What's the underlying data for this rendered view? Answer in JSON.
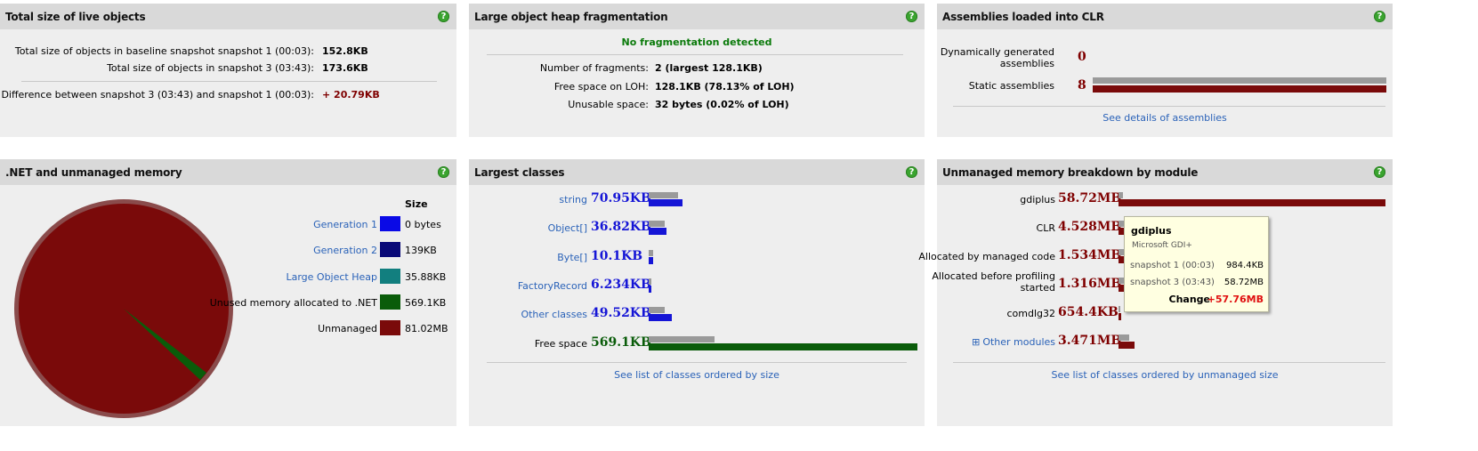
{
  "colors": {
    "managed_bar": "#1515d6",
    "baseline_bar": "#9a9a9a",
    "free_bar": "#0a5c0a",
    "unmanaged_bar": "#7a0a0a",
    "help_icon": "#3aa42f"
  },
  "live": {
    "title": "Total size of live objects",
    "rows": [
      {
        "label": "Total size of objects in baseline snapshot snapshot 1 (00:03):",
        "value": "152.8KB"
      },
      {
        "label": "Total size of objects in snapshot 3 (03:43):",
        "value": "173.6KB"
      }
    ],
    "diff_label": "Difference between snapshot 3 (03:43) and snapshot 1 (00:03):",
    "diff_value": "+ 20.79KB"
  },
  "loh": {
    "title": "Large object heap fragmentation",
    "status": "No fragmentation detected",
    "rows": [
      {
        "label": "Number of fragments:",
        "value": "2 (largest 128.1KB)"
      },
      {
        "label": "Free space on LOH:",
        "value": "128.1KB (78.13% of LOH)"
      },
      {
        "label": "Unusable space:",
        "value": "32 bytes (0.02% of LOH)"
      }
    ]
  },
  "assemblies": {
    "title": "Assemblies loaded into CLR",
    "dynamic_label_1": "Dynamically generated",
    "dynamic_label_2": "assemblies",
    "dynamic_value": "0",
    "static_label": "Static assemblies",
    "static_value": "8",
    "static_fraction": 1.0,
    "link": "See details of assemblies"
  },
  "net": {
    "title": ".NET and unmanaged memory",
    "size_header": "Size",
    "legend": [
      {
        "label": "Generation 1",
        "value": "0 bytes",
        "color": "#0a0ae6",
        "link": true
      },
      {
        "label": "Generation 2",
        "value": "139KB",
        "color": "#0a0a78",
        "link": true
      },
      {
        "label": "Large Object Heap",
        "value": "35.88KB",
        "color": "#127f7f",
        "link": true
      },
      {
        "label": "Unused memory allocated to .NET",
        "value": "569.1KB",
        "color": "#0a5c0a",
        "link": false
      },
      {
        "label": "Unmanaged",
        "value": "81.02MB",
        "color": "#7a0a0a",
        "link": false
      }
    ]
  },
  "classes": {
    "title": "Largest classes",
    "rows": [
      {
        "name": "string",
        "value": "70.95KB",
        "baseline_kb": 62.0,
        "current_kb": 70.95,
        "link": true,
        "kind": "managed"
      },
      {
        "name": "Object[]",
        "value": "36.82KB",
        "baseline_kb": 33.0,
        "current_kb": 36.82,
        "link": true,
        "kind": "managed"
      },
      {
        "name": "Byte[]",
        "value": "10.1KB",
        "baseline_kb": 9.0,
        "current_kb": 10.1,
        "link": true,
        "kind": "managed"
      },
      {
        "name": "FactoryRecord",
        "value": "6.234KB",
        "baseline_kb": 5.5,
        "current_kb": 6.234,
        "link": true,
        "kind": "managed"
      },
      {
        "name": "Other classes",
        "value": "49.52KB",
        "baseline_kb": 33.0,
        "current_kb": 49.52,
        "link": true,
        "kind": "managed"
      },
      {
        "name": "Free space",
        "value": "569.1KB",
        "baseline_kb": 140.0,
        "current_kb": 569.1,
        "link": false,
        "kind": "free"
      }
    ],
    "link": "See list of classes ordered by size"
  },
  "unmanaged": {
    "title": "Unmanaged memory breakdown by module",
    "rows": [
      {
        "name_1": "gdiplus",
        "name_2": "",
        "value": "58.72MB",
        "baseline_mb": 0.98,
        "current_mb": 58.72,
        "link": false
      },
      {
        "name_1": "CLR",
        "name_2": "",
        "value": "4.528MB",
        "baseline_mb": 4.2,
        "current_mb": 4.528,
        "link": false
      },
      {
        "name_1": "Allocated by managed code",
        "name_2": "",
        "value": "1.534MB",
        "baseline_mb": 1.3,
        "current_mb": 1.534,
        "link": false
      },
      {
        "name_1": "Allocated before profiling",
        "name_2": "started",
        "value": "1.316MB",
        "baseline_mb": 1.2,
        "current_mb": 1.316,
        "link": false
      },
      {
        "name_1": "comdlg32",
        "name_2": "",
        "value": "654.4KB",
        "baseline_mb": 0.0,
        "current_mb": 0.64,
        "link": false
      },
      {
        "name_1": "Other modules",
        "name_2": "",
        "value": "3.471MB",
        "baseline_mb": 2.4,
        "current_mb": 3.471,
        "link": true
      }
    ],
    "expand_glyph": "⊞",
    "link": "See list of classes ordered by unmanaged size",
    "tooltip": {
      "title": "gdiplus",
      "subtitle": "Microsoft GDI+",
      "rows": [
        {
          "label": "snapshot 1 (00:03)",
          "value": "984.4KB"
        },
        {
          "label": "snapshot 3 (03:43)",
          "value": "58.72MB"
        }
      ],
      "change_label": "Change",
      "change_value": "+57.76MB"
    }
  }
}
